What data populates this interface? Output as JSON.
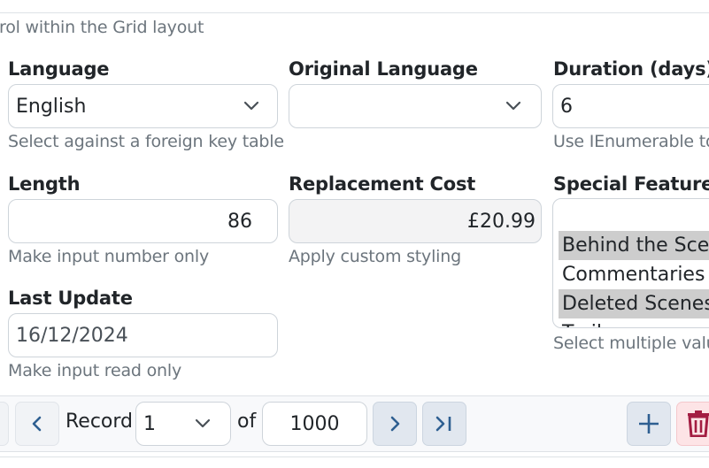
{
  "intro_text": "rol within the Grid layout",
  "fields": {
    "language": {
      "label": "Language",
      "value": "English",
      "hint": "Select against a foreign key table"
    },
    "original_language": {
      "label": "Original Language",
      "value": ""
    },
    "duration": {
      "label": "Duration (days)",
      "value": "6",
      "hint": "Use IEnumerable to"
    },
    "length": {
      "label": "Length",
      "value": "86",
      "hint": "Make input number only"
    },
    "replacement_cost": {
      "label": "Replacement Cost",
      "value": "£20.99",
      "hint": "Apply custom styling"
    },
    "special_features": {
      "label": "Special Features",
      "options": [
        {
          "label": "Behind the Scenes",
          "selected": true
        },
        {
          "label": "Commentaries",
          "selected": false
        },
        {
          "label": "Deleted Scenes",
          "selected": true
        },
        {
          "label": "Trailers",
          "selected": false
        }
      ],
      "hint": "Select multiple valu"
    },
    "last_update": {
      "label": "Last Update",
      "value": "16/12/2024",
      "hint": "Make input read only"
    }
  },
  "navigator": {
    "record_label": "Record",
    "current_record": "1",
    "of_label": "of",
    "total_records": "1000"
  },
  "colors": {
    "accent": "#2e5f91",
    "danger": "#a31d42",
    "hint": "#6c757d",
    "selected_option": "#cdcdcd"
  }
}
